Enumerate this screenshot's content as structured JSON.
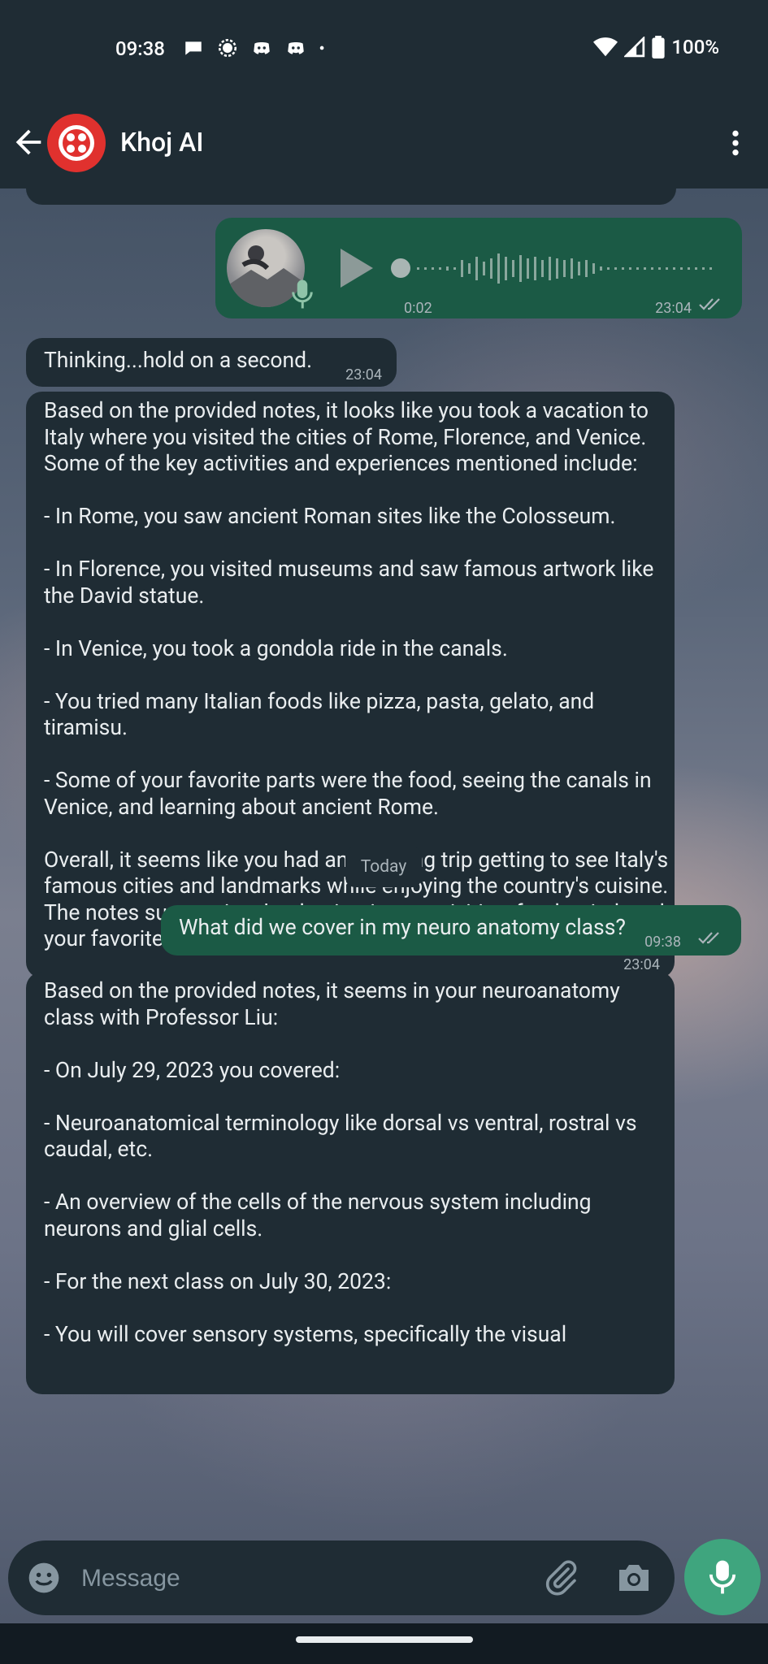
{
  "status_bar": {
    "time": "09:38",
    "battery": "100%"
  },
  "header": {
    "title": "Khoj AI"
  },
  "messages": {
    "voice": {
      "duration": "0:02",
      "time": "23:04"
    },
    "thinking": {
      "text": "Thinking...hold on a second.",
      "time": "23:04"
    },
    "italy": {
      "text": "Based on the provided notes, it looks like you took a vacation to Italy where you visited the cities of Rome, Florence, and Venice. Some of the key activities and experiences mentioned include:\n\n- In Rome, you saw ancient Roman sites like the Colosseum.\n\n- In Florence, you visited museums and saw famous artwork like the David statue.\n\n- In Venice, you took a gondola ride in the canals.\n\n- You tried many Italian foods like pizza, pasta, gelato, and tiramisu.\n\n- Some of your favorite parts were the food, seeing the canals in Venice, and learning about ancient Rome.\n\nOverall, it seems like you had an amazing trip getting to see Italy's famous cities and landmarks while enjoying the country's cuisine. The notes summarize the destinations, activities, foods tried, and your favorite parts of the vacation.",
      "time": "23:04"
    },
    "day_chip": "Today",
    "question": {
      "text": "What did we cover in my neuro anatomy class?",
      "time": "09:38"
    },
    "neuro": {
      "text": "Based on the provided notes, it seems in your neuroanatomy class with Professor Liu:\n\n- On July 29, 2023 you covered:\n\n- Neuroanatomical terminology like dorsal vs ventral, rostral vs caudal, etc.\n\n- An overview of the cells of the nervous system including neurons and glial cells.\n\n- For the next class on July 30, 2023:\n\n- You will cover sensory systems, specifically the visual"
    }
  },
  "input": {
    "placeholder": "Message"
  },
  "colors": {
    "incoming_bubble": "#1f2c34",
    "outgoing_bubble": "#1b5a45",
    "fab": "#3fa57e",
    "header": "#1f2c34",
    "avatar": "#e0312e"
  }
}
